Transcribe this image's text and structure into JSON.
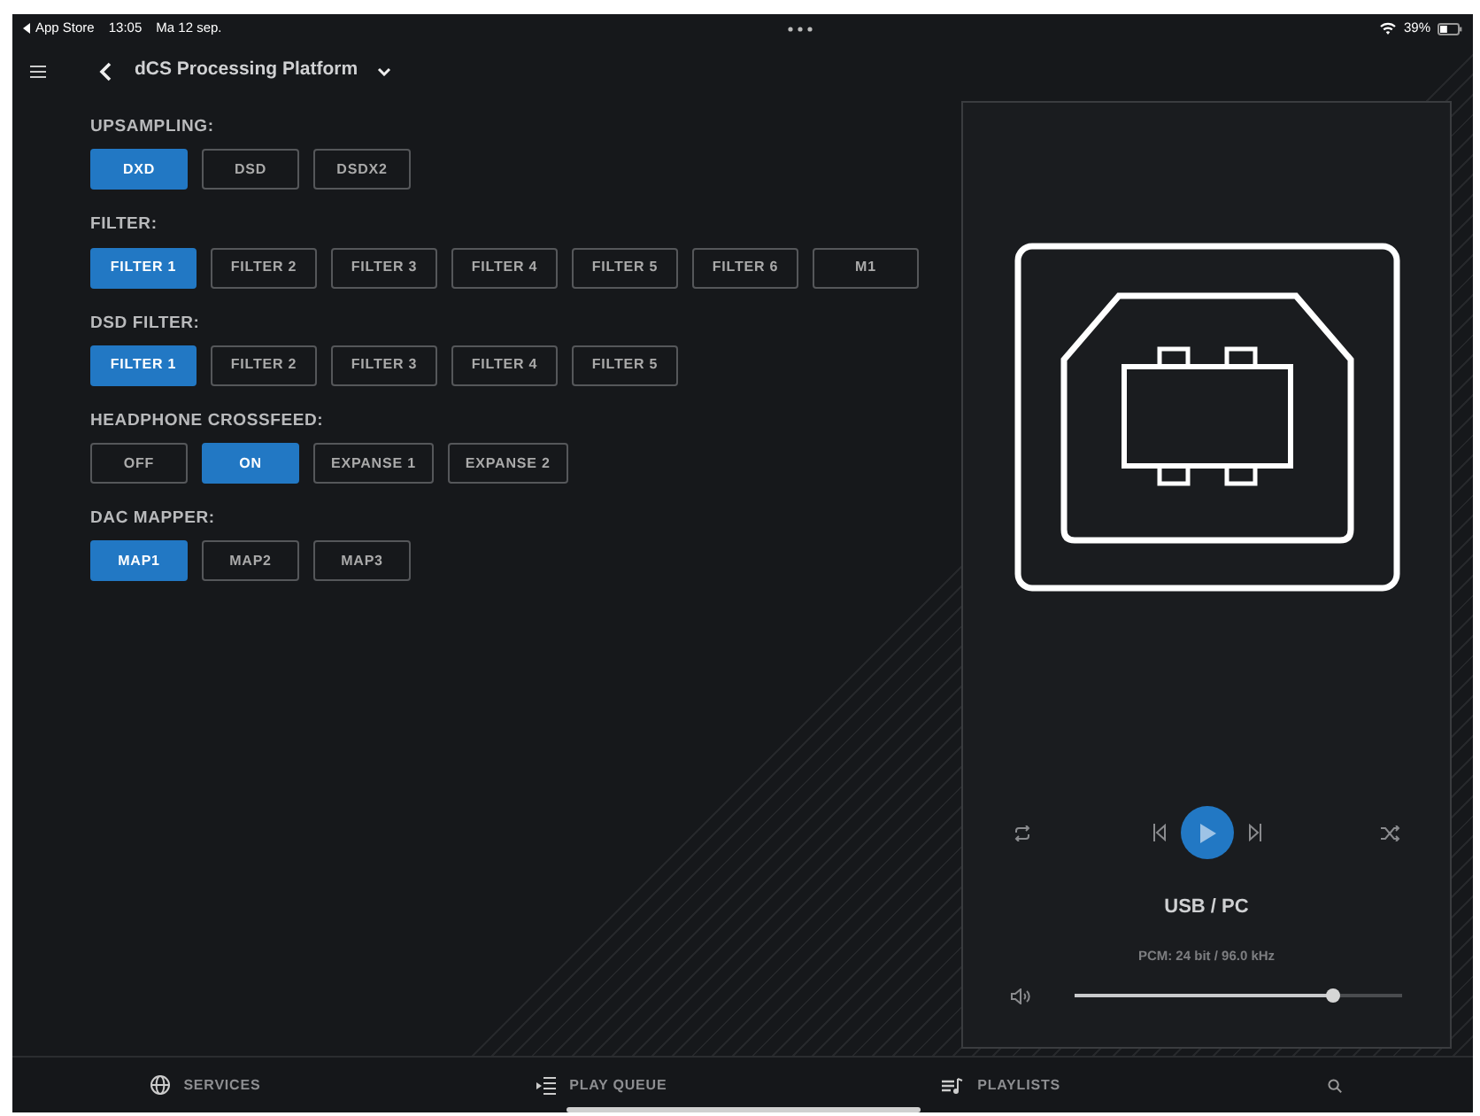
{
  "status_bar": {
    "back_app": "App Store",
    "time": "13:05",
    "date": "Ma 12 sep.",
    "battery": "39%"
  },
  "header": {
    "title": "dCS Processing Platform"
  },
  "groups": [
    {
      "label": "UPSAMPLING:",
      "options": [
        {
          "label": "DXD",
          "selected": true
        },
        {
          "label": "DSD",
          "selected": false
        },
        {
          "label": "DSDX2",
          "selected": false
        }
      ]
    },
    {
      "label": "FILTER:",
      "options": [
        {
          "label": "FILTER 1",
          "selected": true
        },
        {
          "label": "FILTER 2",
          "selected": false
        },
        {
          "label": "FILTER 3",
          "selected": false
        },
        {
          "label": "FILTER 4",
          "selected": false
        },
        {
          "label": "FILTER 5",
          "selected": false
        },
        {
          "label": "FILTER 6",
          "selected": false
        },
        {
          "label": "M1",
          "selected": false
        }
      ]
    },
    {
      "label": "DSD FILTER:",
      "options": [
        {
          "label": "FILTER 1",
          "selected": true
        },
        {
          "label": "FILTER 2",
          "selected": false
        },
        {
          "label": "FILTER 3",
          "selected": false
        },
        {
          "label": "FILTER 4",
          "selected": false
        },
        {
          "label": "FILTER 5",
          "selected": false
        }
      ]
    },
    {
      "label": "HEADPHONE CROSSFEED:",
      "options": [
        {
          "label": "OFF",
          "selected": false
        },
        {
          "label": "ON",
          "selected": true
        },
        {
          "label": "EXPANSE 1",
          "selected": false
        },
        {
          "label": "EXPANSE 2",
          "selected": false
        }
      ]
    },
    {
      "label": "DAC MAPPER:",
      "options": [
        {
          "label": "MAP1",
          "selected": true
        },
        {
          "label": "MAP2",
          "selected": false
        },
        {
          "label": "MAP3",
          "selected": false
        }
      ]
    }
  ],
  "player": {
    "source": "USB / PC",
    "format": "PCM: 24 bit / 96.0 kHz",
    "volume": {
      "level": 0.79
    }
  },
  "nav": [
    {
      "kind": "globe",
      "label": "SERVICES"
    },
    {
      "kind": "queue",
      "label": "PLAY QUEUE"
    },
    {
      "kind": "playlists",
      "label": "PLAYLISTS"
    },
    {
      "kind": "search"
    }
  ]
}
